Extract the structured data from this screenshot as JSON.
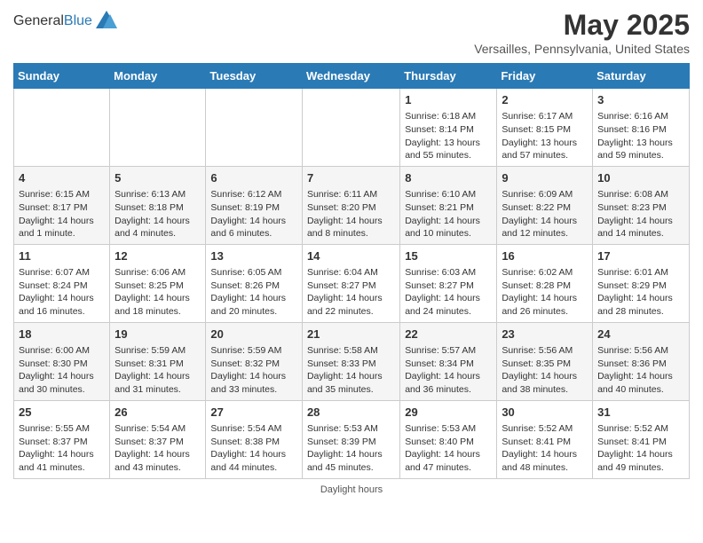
{
  "header": {
    "logo_general": "General",
    "logo_blue": "Blue",
    "month_title": "May 2025",
    "subtitle": "Versailles, Pennsylvania, United States"
  },
  "days_of_week": [
    "Sunday",
    "Monday",
    "Tuesday",
    "Wednesday",
    "Thursday",
    "Friday",
    "Saturday"
  ],
  "weeks": [
    [
      {
        "day": "",
        "text": ""
      },
      {
        "day": "",
        "text": ""
      },
      {
        "day": "",
        "text": ""
      },
      {
        "day": "",
        "text": ""
      },
      {
        "day": "1",
        "text": "Sunrise: 6:18 AM\nSunset: 8:14 PM\nDaylight: 13 hours and 55 minutes."
      },
      {
        "day": "2",
        "text": "Sunrise: 6:17 AM\nSunset: 8:15 PM\nDaylight: 13 hours and 57 minutes."
      },
      {
        "day": "3",
        "text": "Sunrise: 6:16 AM\nSunset: 8:16 PM\nDaylight: 13 hours and 59 minutes."
      }
    ],
    [
      {
        "day": "4",
        "text": "Sunrise: 6:15 AM\nSunset: 8:17 PM\nDaylight: 14 hours and 1 minute."
      },
      {
        "day": "5",
        "text": "Sunrise: 6:13 AM\nSunset: 8:18 PM\nDaylight: 14 hours and 4 minutes."
      },
      {
        "day": "6",
        "text": "Sunrise: 6:12 AM\nSunset: 8:19 PM\nDaylight: 14 hours and 6 minutes."
      },
      {
        "day": "7",
        "text": "Sunrise: 6:11 AM\nSunset: 8:20 PM\nDaylight: 14 hours and 8 minutes."
      },
      {
        "day": "8",
        "text": "Sunrise: 6:10 AM\nSunset: 8:21 PM\nDaylight: 14 hours and 10 minutes."
      },
      {
        "day": "9",
        "text": "Sunrise: 6:09 AM\nSunset: 8:22 PM\nDaylight: 14 hours and 12 minutes."
      },
      {
        "day": "10",
        "text": "Sunrise: 6:08 AM\nSunset: 8:23 PM\nDaylight: 14 hours and 14 minutes."
      }
    ],
    [
      {
        "day": "11",
        "text": "Sunrise: 6:07 AM\nSunset: 8:24 PM\nDaylight: 14 hours and 16 minutes."
      },
      {
        "day": "12",
        "text": "Sunrise: 6:06 AM\nSunset: 8:25 PM\nDaylight: 14 hours and 18 minutes."
      },
      {
        "day": "13",
        "text": "Sunrise: 6:05 AM\nSunset: 8:26 PM\nDaylight: 14 hours and 20 minutes."
      },
      {
        "day": "14",
        "text": "Sunrise: 6:04 AM\nSunset: 8:27 PM\nDaylight: 14 hours and 22 minutes."
      },
      {
        "day": "15",
        "text": "Sunrise: 6:03 AM\nSunset: 8:27 PM\nDaylight: 14 hours and 24 minutes."
      },
      {
        "day": "16",
        "text": "Sunrise: 6:02 AM\nSunset: 8:28 PM\nDaylight: 14 hours and 26 minutes."
      },
      {
        "day": "17",
        "text": "Sunrise: 6:01 AM\nSunset: 8:29 PM\nDaylight: 14 hours and 28 minutes."
      }
    ],
    [
      {
        "day": "18",
        "text": "Sunrise: 6:00 AM\nSunset: 8:30 PM\nDaylight: 14 hours and 30 minutes."
      },
      {
        "day": "19",
        "text": "Sunrise: 5:59 AM\nSunset: 8:31 PM\nDaylight: 14 hours and 31 minutes."
      },
      {
        "day": "20",
        "text": "Sunrise: 5:59 AM\nSunset: 8:32 PM\nDaylight: 14 hours and 33 minutes."
      },
      {
        "day": "21",
        "text": "Sunrise: 5:58 AM\nSunset: 8:33 PM\nDaylight: 14 hours and 35 minutes."
      },
      {
        "day": "22",
        "text": "Sunrise: 5:57 AM\nSunset: 8:34 PM\nDaylight: 14 hours and 36 minutes."
      },
      {
        "day": "23",
        "text": "Sunrise: 5:56 AM\nSunset: 8:35 PM\nDaylight: 14 hours and 38 minutes."
      },
      {
        "day": "24",
        "text": "Sunrise: 5:56 AM\nSunset: 8:36 PM\nDaylight: 14 hours and 40 minutes."
      }
    ],
    [
      {
        "day": "25",
        "text": "Sunrise: 5:55 AM\nSunset: 8:37 PM\nDaylight: 14 hours and 41 minutes."
      },
      {
        "day": "26",
        "text": "Sunrise: 5:54 AM\nSunset: 8:37 PM\nDaylight: 14 hours and 43 minutes."
      },
      {
        "day": "27",
        "text": "Sunrise: 5:54 AM\nSunset: 8:38 PM\nDaylight: 14 hours and 44 minutes."
      },
      {
        "day": "28",
        "text": "Sunrise: 5:53 AM\nSunset: 8:39 PM\nDaylight: 14 hours and 45 minutes."
      },
      {
        "day": "29",
        "text": "Sunrise: 5:53 AM\nSunset: 8:40 PM\nDaylight: 14 hours and 47 minutes."
      },
      {
        "day": "30",
        "text": "Sunrise: 5:52 AM\nSunset: 8:41 PM\nDaylight: 14 hours and 48 minutes."
      },
      {
        "day": "31",
        "text": "Sunrise: 5:52 AM\nSunset: 8:41 PM\nDaylight: 14 hours and 49 minutes."
      }
    ]
  ],
  "footer": {
    "label": "Daylight hours"
  }
}
